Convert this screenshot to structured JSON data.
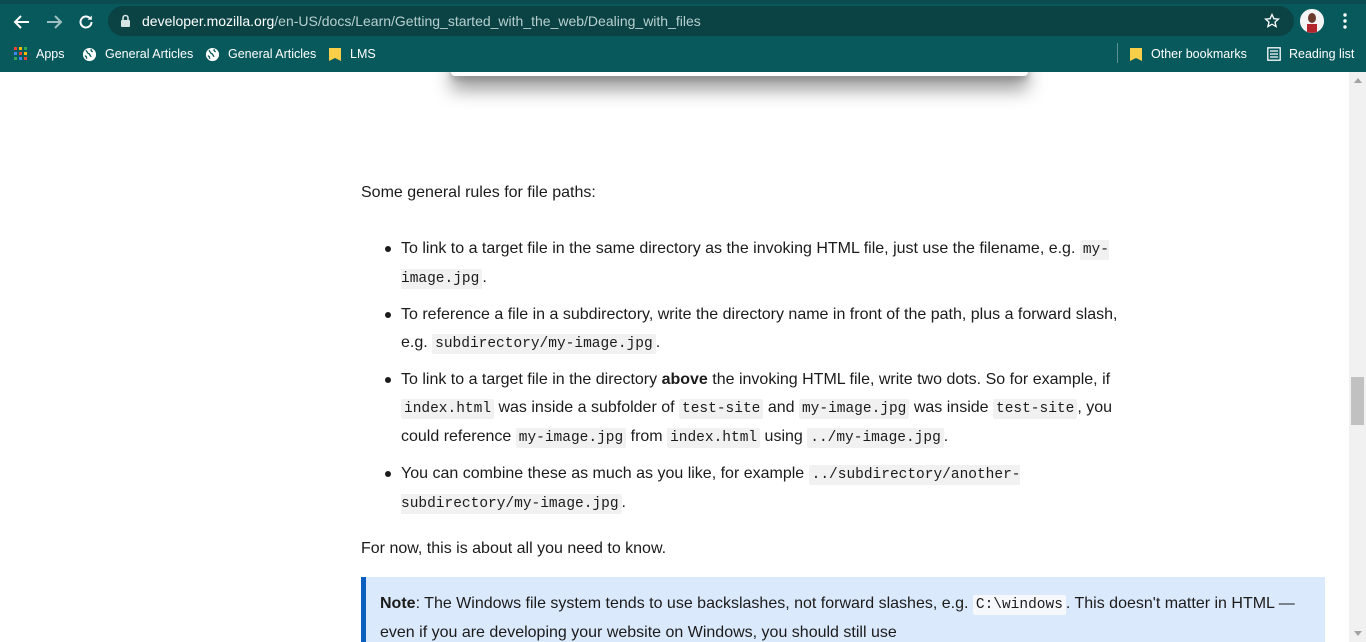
{
  "browser": {
    "url_host": "developer.mozilla.org",
    "url_path": "/en-US/docs/Learn/Getting_started_with_the_web/Dealing_with_files",
    "bookmarks": [
      {
        "label": "Apps",
        "icon": "apps-grid-icon"
      },
      {
        "label": "General Articles",
        "icon": "globe-icon"
      },
      {
        "label": "General Articles",
        "icon": "globe-icon"
      },
      {
        "label": "LMS",
        "icon": "folder-icon"
      }
    ],
    "other_bookmarks": "Other bookmarks",
    "reading_list": "Reading list",
    "colors": {
      "toolbar": "#08595c",
      "omnibox": "#0b4345"
    }
  },
  "article": {
    "rules_title": "Some general rules for file paths:",
    "rules": [
      {
        "text": "To link to a target file in the same directory as the invoking HTML file, just use the filename, e.g.",
        "code": "my-image.jpg",
        "end": "."
      },
      {
        "text": "To reference a file in a subdirectory, write the directory name in front of the path, plus a forward slash, e.g.",
        "code": "subdirectory/my-image.jpg",
        "end": "."
      },
      {
        "t1": "To link to a target file in the directory",
        "bold": "above",
        "t2": "the invoking HTML file, write two dots. So for example, if",
        "c1": "index.html",
        "t3": "was inside a subfolder of",
        "c2": "test-site",
        "t4": "and",
        "c3": "my-image.jpg",
        "t5": "was inside",
        "c4": "test-site",
        "t6": ", you could reference",
        "c5": "my-image.jpg",
        "t7": "from",
        "c6": "index.html",
        "t8": "using",
        "c7": "../my-image.jpg",
        "end": "."
      },
      {
        "text": "You can combine these as much as you like, for example",
        "code": "../subdirectory/another-subdirectory/my-image.jpg",
        "end": "."
      }
    ],
    "for_now": "For now, this is about all you need to know.",
    "note": {
      "label": "Note",
      "t1": ": The Windows file system tends to use backslashes, not forward slashes, e.g.",
      "code": "C:\\windows",
      "t2": ". This doesn't matter in HTML — even if you are developing your website on Windows, you should still use"
    },
    "colors": {
      "note_bg": "#dbe9fc",
      "note_border": "#0b5fbf"
    }
  }
}
